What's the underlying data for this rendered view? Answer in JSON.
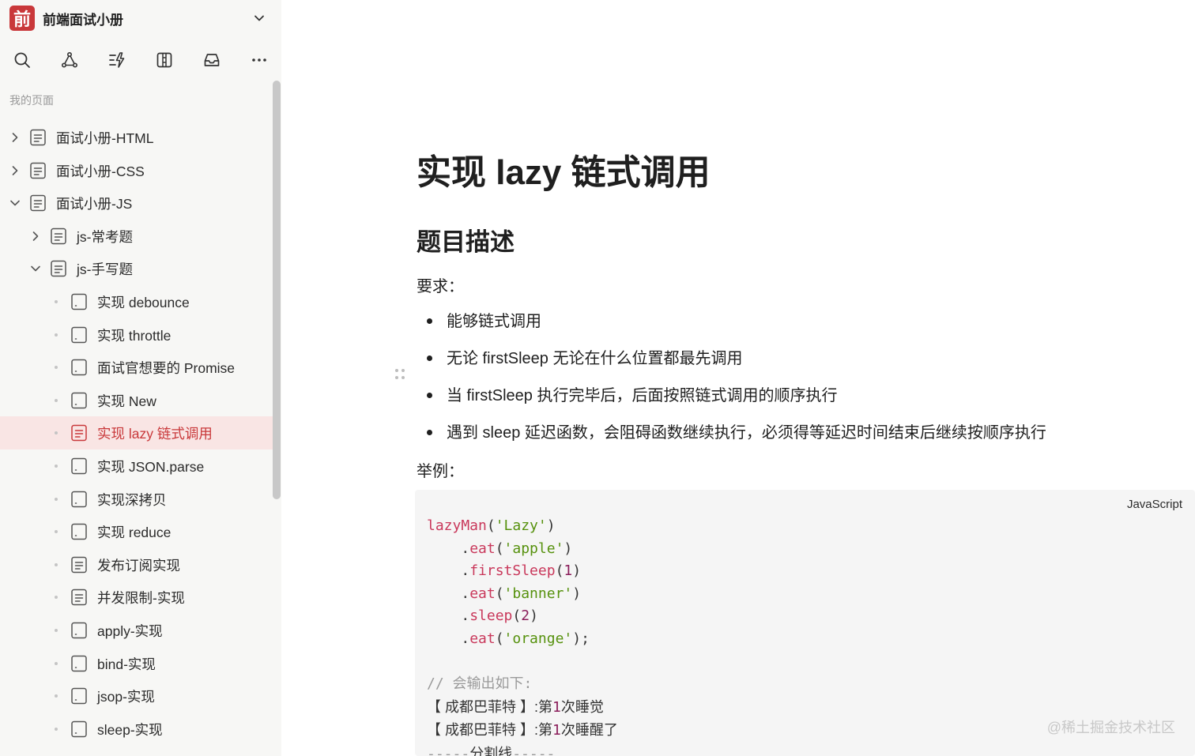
{
  "workspace": {
    "logo_char": "前",
    "name": "前端面试小册"
  },
  "toolbar": {
    "icons": [
      "search-icon",
      "graph-icon",
      "quick-action-icon",
      "table-view-icon",
      "inbox-icon",
      "more-icon"
    ]
  },
  "sidebar": {
    "section_label": "我的页面",
    "items": [
      {
        "label": "面试小册-HTML",
        "level": 0,
        "expander": "collapsed",
        "icon": "doc-filled"
      },
      {
        "label": "面试小册-CSS",
        "level": 0,
        "expander": "collapsed",
        "icon": "doc-filled"
      },
      {
        "label": "面试小册-JS",
        "level": 0,
        "expander": "expanded",
        "icon": "doc-filled"
      },
      {
        "label": "js-常考题",
        "level": 1,
        "expander": "collapsed",
        "icon": "doc-filled"
      },
      {
        "label": "js-手写题",
        "level": 1,
        "expander": "expanded",
        "icon": "doc-filled"
      },
      {
        "label": "实现 debounce",
        "level": 2,
        "expander": "dot",
        "icon": "doc-empty"
      },
      {
        "label": "实现 throttle",
        "level": 2,
        "expander": "dot",
        "icon": "doc-empty"
      },
      {
        "label": "面试官想要的 Promise",
        "level": 2,
        "expander": "dot",
        "icon": "doc-empty"
      },
      {
        "label": "实现 New",
        "level": 2,
        "expander": "dot",
        "icon": "doc-empty"
      },
      {
        "label": "实现 lazy 链式调用",
        "level": 2,
        "expander": "dot",
        "icon": "doc-filled",
        "active": true
      },
      {
        "label": "实现 JSON.parse",
        "level": 2,
        "expander": "dot",
        "icon": "doc-empty"
      },
      {
        "label": "实现深拷贝",
        "level": 2,
        "expander": "dot",
        "icon": "doc-empty"
      },
      {
        "label": "实现 reduce",
        "level": 2,
        "expander": "dot",
        "icon": "doc-empty"
      },
      {
        "label": "发布订阅实现",
        "level": 2,
        "expander": "dot",
        "icon": "doc-filled"
      },
      {
        "label": "并发限制-实现",
        "level": 2,
        "expander": "dot",
        "icon": "doc-filled"
      },
      {
        "label": "apply-实现",
        "level": 2,
        "expander": "dot",
        "icon": "doc-empty"
      },
      {
        "label": "bind-实现",
        "level": 2,
        "expander": "dot",
        "icon": "doc-empty"
      },
      {
        "label": "jsop-实现",
        "level": 2,
        "expander": "dot",
        "icon": "doc-empty"
      },
      {
        "label": "sleep-实现",
        "level": 2,
        "expander": "dot",
        "icon": "doc-empty"
      }
    ]
  },
  "page": {
    "title": "实现 lazy 链式调用",
    "heading": "题目描述",
    "requirements_label": "要求：",
    "bullets": [
      "能够链式调用",
      "无论 firstSleep 无论在什么位置都最先调用",
      "当 firstSleep 执行完毕后，后面按照链式调用的顺序执行",
      "遇到 sleep 延迟函数，会阻碍函数继续执行，必须得等延迟时间结束后继续按顺序执行"
    ],
    "example_label": "举例：",
    "code_language": "JavaScript",
    "code_lines": [
      [
        [
          "fn",
          "lazyMan"
        ],
        [
          "plain",
          "("
        ],
        [
          "str",
          "'Lazy'"
        ],
        [
          "plain",
          ")"
        ]
      ],
      [
        [
          "plain",
          "    ."
        ],
        [
          "fn",
          "eat"
        ],
        [
          "plain",
          "("
        ],
        [
          "str",
          "'apple'"
        ],
        [
          "plain",
          ")"
        ]
      ],
      [
        [
          "plain",
          "    ."
        ],
        [
          "fn",
          "firstSleep"
        ],
        [
          "plain",
          "("
        ],
        [
          "num",
          "1"
        ],
        [
          "plain",
          ")"
        ]
      ],
      [
        [
          "plain",
          "    ."
        ],
        [
          "fn",
          "eat"
        ],
        [
          "plain",
          "("
        ],
        [
          "str",
          "'banner'"
        ],
        [
          "plain",
          ")"
        ]
      ],
      [
        [
          "plain",
          "    ."
        ],
        [
          "fn",
          "sleep"
        ],
        [
          "plain",
          "("
        ],
        [
          "num",
          "2"
        ],
        [
          "plain",
          ")"
        ]
      ],
      [
        [
          "plain",
          "    ."
        ],
        [
          "fn",
          "eat"
        ],
        [
          "plain",
          "("
        ],
        [
          "str",
          "'orange'"
        ],
        [
          "plain",
          ");"
        ]
      ],
      [
        [
          "plain",
          ""
        ]
      ],
      [
        [
          "com",
          "// 会输出如下:"
        ]
      ],
      [
        [
          "text",
          "【 成都巴菲特 】:第"
        ],
        [
          "num",
          "1"
        ],
        [
          "text",
          "次睡觉"
        ]
      ],
      [
        [
          "text",
          "【 成都巴菲特 】:第"
        ],
        [
          "num",
          "1"
        ],
        [
          "text",
          "次睡醒了"
        ]
      ],
      [
        [
          "com",
          "-----"
        ],
        [
          "text",
          "分割线"
        ],
        [
          "com",
          "-----"
        ]
      ]
    ]
  },
  "watermark": "@稀土掘金技术社区",
  "colors": {
    "brand": "#c9383a",
    "active_bg": "#f9e5e4",
    "sidebar_bg": "#f7f7f5",
    "code_bg": "#f5f5f5"
  }
}
